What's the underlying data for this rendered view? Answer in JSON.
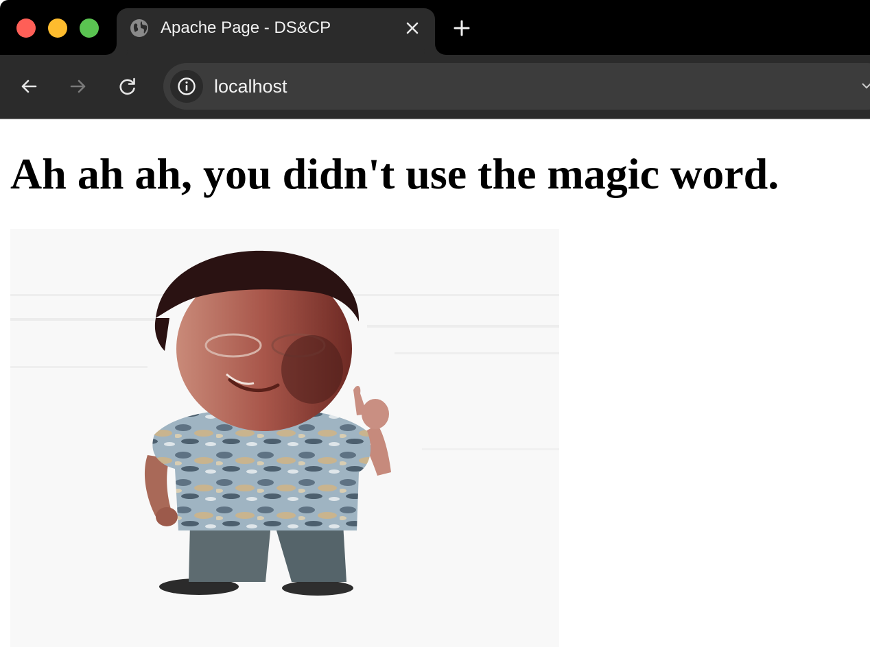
{
  "window": {
    "controls": [
      "close",
      "minimize",
      "maximize"
    ]
  },
  "tab": {
    "title": "Apache Page - DS&CP",
    "favicon": "globe-icon"
  },
  "toolbar": {
    "back_icon": "arrow-left-icon",
    "forward_icon": "arrow-right-icon",
    "reload_icon": "reload-icon",
    "site_info_icon": "info-icon",
    "url": "localhost"
  },
  "page": {
    "heading": "Ah ah ah, you didn't use the magic word.",
    "image": "cartoon-man-wagging-finger"
  },
  "colors": {
    "tab_strip": "#000000",
    "toolbar": "#2b2b2b",
    "omnibox": "#3c3c3c",
    "close": "#fe5f57",
    "minimize": "#febc2e",
    "maximize": "#5ac451"
  }
}
